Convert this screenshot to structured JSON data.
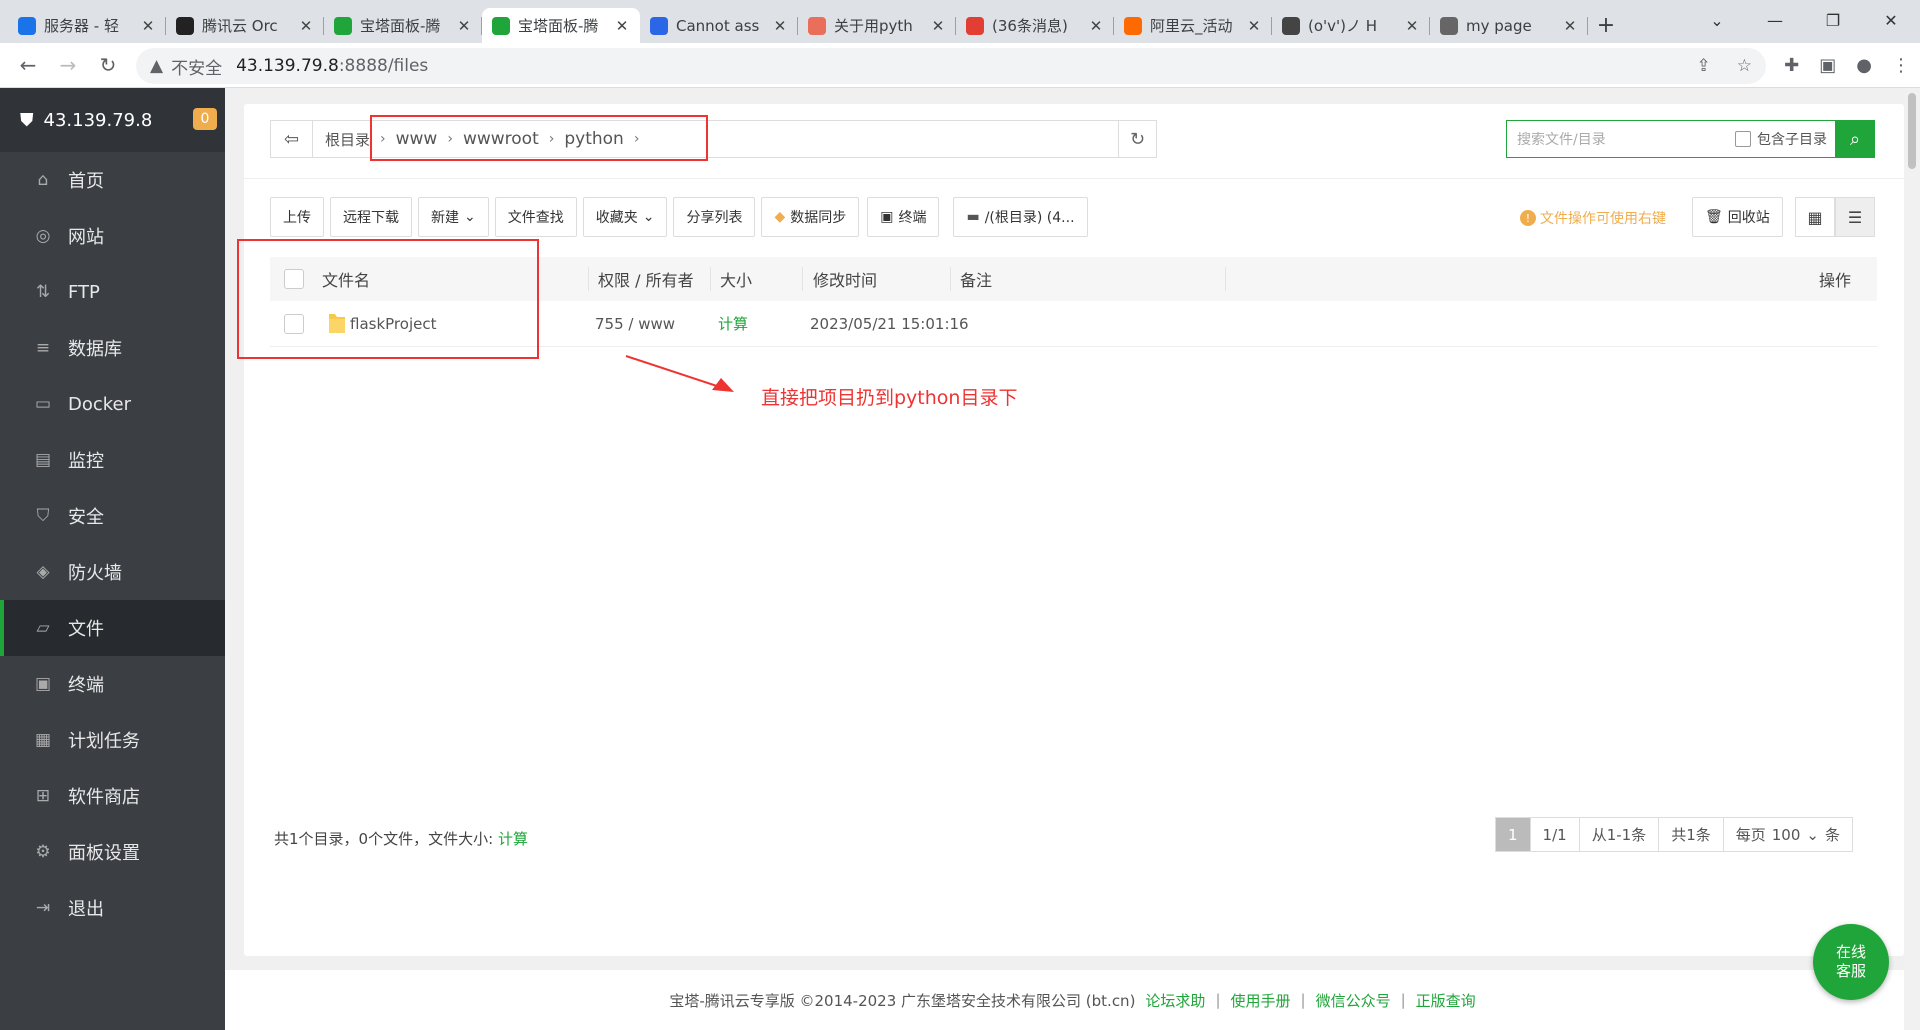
{
  "browser": {
    "tabs": [
      {
        "label": "服务器 - 轻",
        "icon": "cloud-icon",
        "color": "#1a73e8"
      },
      {
        "label": "腾讯云 Orc",
        "icon": "play-icon",
        "color": "#222222"
      },
      {
        "label": "宝塔面板-腾",
        "icon": "shield-icon",
        "color": "#20a53a"
      },
      {
        "label": "宝塔面板-腾",
        "icon": "shield-icon",
        "color": "#20a53a"
      },
      {
        "label": "Cannot ass",
        "icon": "paw-icon",
        "color": "#2b66e6"
      },
      {
        "label": "关于用pyth",
        "icon": "jian-icon",
        "color": "#ea6f5a"
      },
      {
        "label": "(36条消息)",
        "icon": "csdn-icon",
        "color": "#e33e33"
      },
      {
        "label": "阿里云_活动",
        "icon": "aliyun-icon",
        "color": "#ff6a00"
      },
      {
        "label": "(o'v')ノ H",
        "icon": "pen-icon",
        "color": "#444444"
      },
      {
        "label": "my page",
        "icon": "globe-icon",
        "color": "#666666"
      }
    ],
    "active_tab": 3,
    "address": {
      "insecure": "不安全",
      "host": "43.139.79.8",
      "path": ":8888/files"
    }
  },
  "sidebar": {
    "server": "43.139.79.8",
    "badge": "0",
    "items": [
      {
        "label": "首页",
        "icon": "home-icon"
      },
      {
        "label": "网站",
        "icon": "globe-icon"
      },
      {
        "label": "FTP",
        "icon": "ftp-icon"
      },
      {
        "label": "数据库",
        "icon": "database-icon"
      },
      {
        "label": "Docker",
        "icon": "docker-icon"
      },
      {
        "label": "监控",
        "icon": "monitor-icon"
      },
      {
        "label": "安全",
        "icon": "shield-check-icon"
      },
      {
        "label": "防火墙",
        "icon": "firewall-icon"
      },
      {
        "label": "文件",
        "icon": "folder-icon"
      },
      {
        "label": "终端",
        "icon": "terminal-icon"
      },
      {
        "label": "计划任务",
        "icon": "calendar-icon"
      },
      {
        "label": "软件商店",
        "icon": "apps-icon"
      },
      {
        "label": "面板设置",
        "icon": "settings-icon"
      },
      {
        "label": "退出",
        "icon": "logout-icon"
      }
    ],
    "active_item": 8
  },
  "files": {
    "breadcrumb": [
      "根目录",
      "www",
      "wwwroot",
      "python"
    ],
    "search_placeholder": "搜索文件/目录",
    "search_subdir": "包含子目录",
    "toolbar": [
      "上传",
      "远程下载",
      "新建",
      "文件查找",
      "收藏夹",
      "分享列表",
      "数据同步",
      "终端",
      "/(根目录) (4..."
    ],
    "hint": "文件操作可使用右键",
    "recycle": "回收站",
    "columns": [
      "文件名",
      "权限 / 所有者",
      "大小",
      "修改时间",
      "备注",
      "操作"
    ],
    "rows": [
      {
        "name": "flaskProject",
        "perm": "755 / www",
        "size": "计算",
        "mtime": "2023/05/21 15:01:16",
        "note": ""
      }
    ],
    "annotation": "直接把项目扔到python目录下",
    "summary_prefix": "共1个目录，0个文件，文件大小:",
    "summary_calc": "计算",
    "pager": {
      "current": "1",
      "pages": "1/1",
      "range": "从1-1条",
      "total": "共1条",
      "per_page_label": "每页",
      "per_page": "100",
      "unit": "条"
    }
  },
  "footer": {
    "copyright": "宝塔-腾讯云专享版 ©2014-2023 广东堡塔安全技术有限公司 (bt.cn)",
    "links": [
      "论坛求助",
      "使用手册",
      "微信公众号",
      "正版查询"
    ]
  },
  "chat": {
    "line1": "在线",
    "line2": "客服"
  }
}
